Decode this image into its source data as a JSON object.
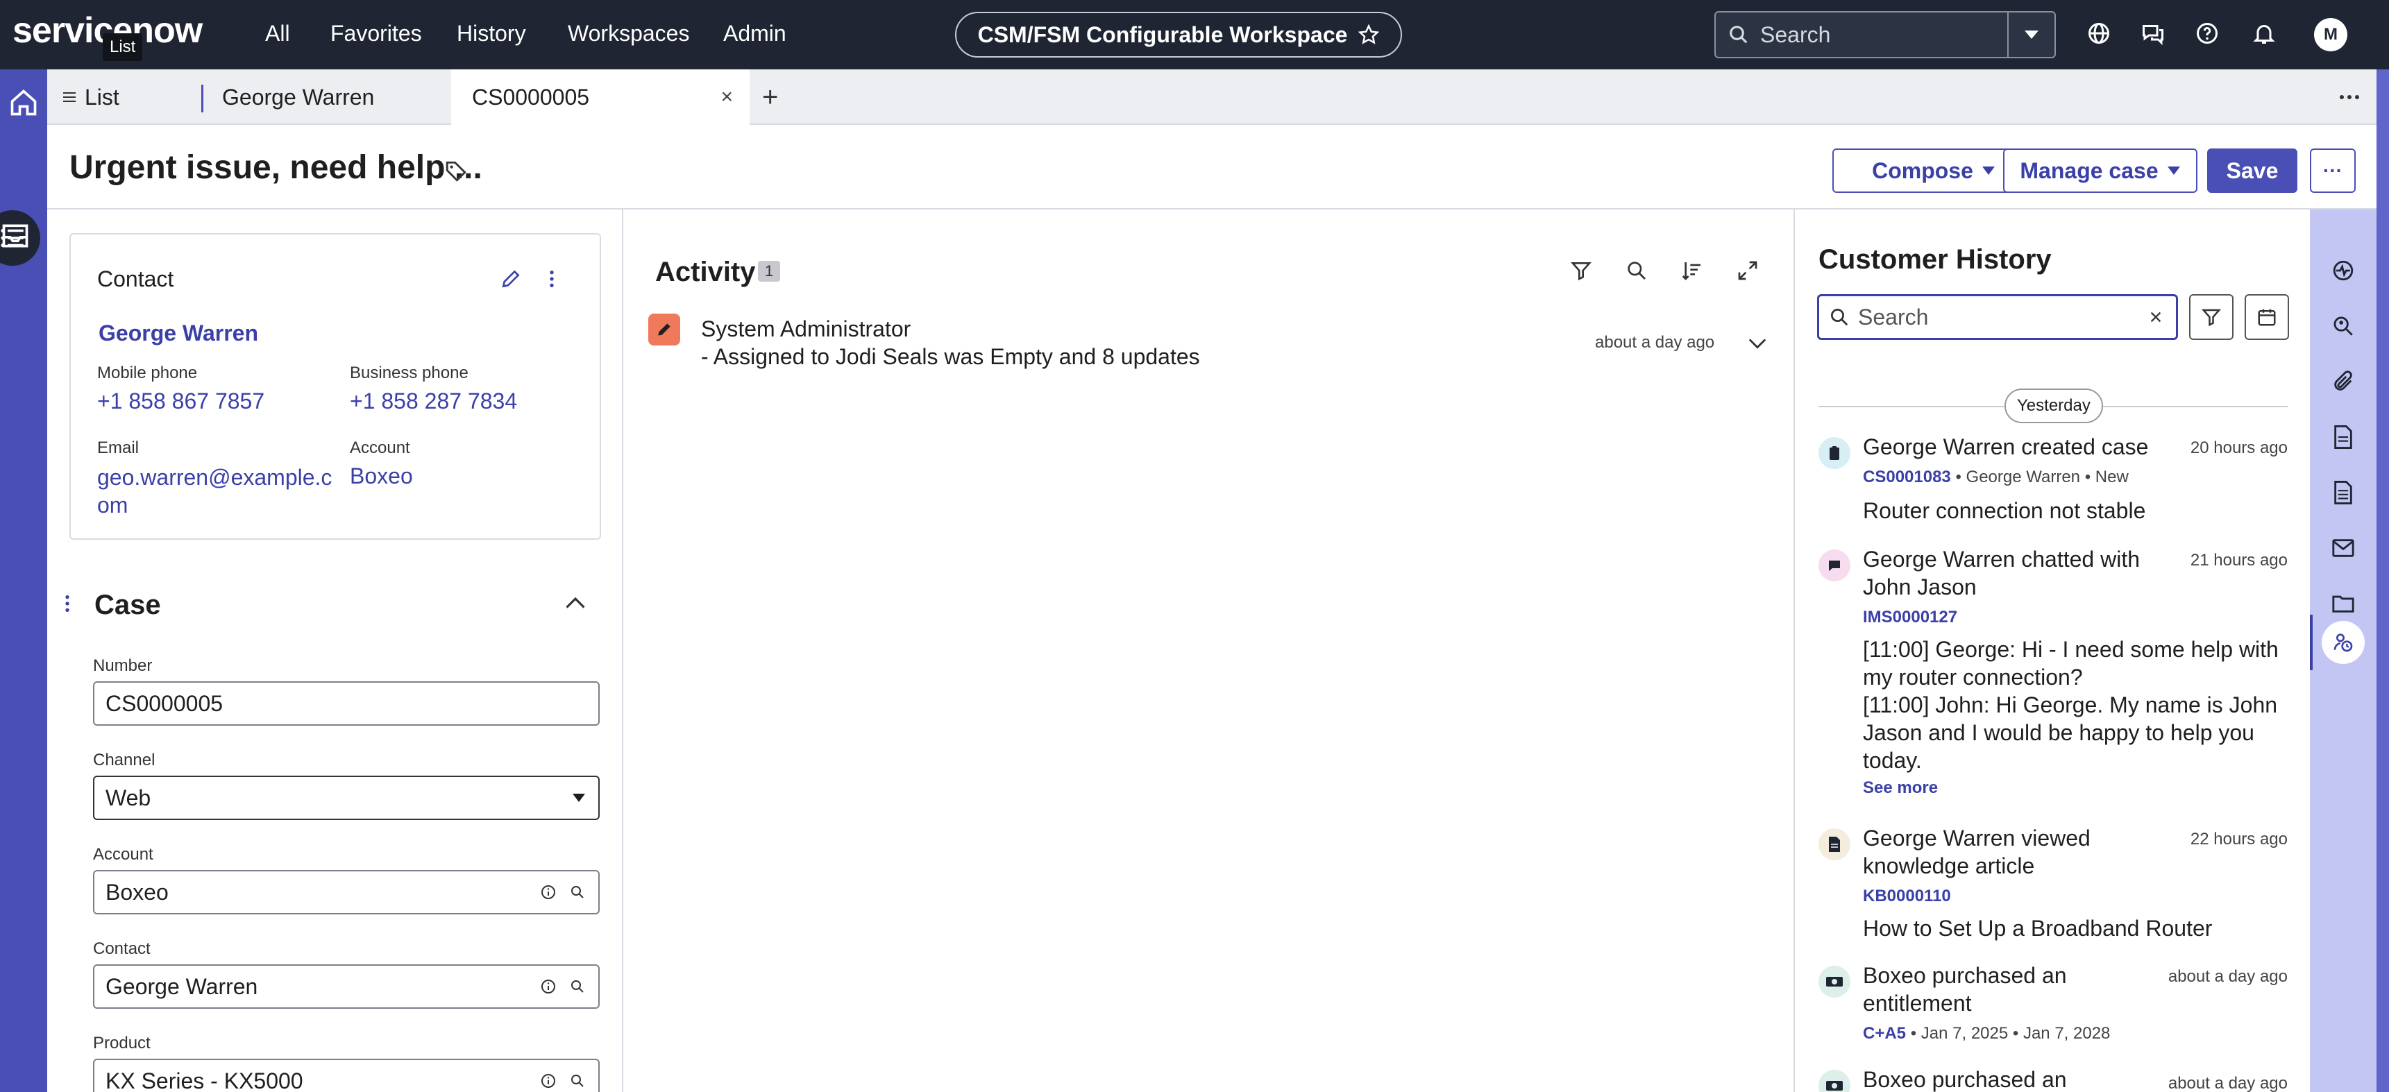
{
  "topnav": {
    "logo": "servicenow",
    "logo_tooltip": "List",
    "links": [
      "All",
      "Favorites",
      "History",
      "Workspaces",
      "Admin"
    ],
    "workspace_name": "CSM/FSM Configurable Workspace",
    "search_placeholder": "Search",
    "avatar_initial": "M"
  },
  "tabs": {
    "list_label": "List",
    "tab1_label": "George Warren",
    "tab2_label": "CS0000005",
    "close_glyph": "×",
    "add_glyph": "+"
  },
  "header": {
    "title": "Urgent issue, need help ...",
    "compose_label": "Compose",
    "manage_label": "Manage case",
    "save_label": "Save",
    "more_label": "···"
  },
  "contact": {
    "heading": "Contact",
    "name": "George Warren",
    "mobile_label": "Mobile phone",
    "mobile_value": "+1 858 867 7857",
    "business_label": "Business phone",
    "business_value": "+1 858 287 7834",
    "email_label": "Email",
    "email_line1": "geo.warren@example.c",
    "email_line2": "om",
    "account_label": "Account",
    "account_value": "Boxeo"
  },
  "case": {
    "heading": "Case",
    "number_label": "Number",
    "number_value": "CS0000005",
    "channel_label": "Channel",
    "channel_value": "Web",
    "account_label": "Account",
    "account_value": "Boxeo",
    "contact_label": "Contact",
    "contact_value": "George Warren",
    "product_label": "Product",
    "product_value": "KX Series - KX5000"
  },
  "activity": {
    "title": "Activity",
    "count": "1",
    "entry_author": "System Administrator",
    "entry_text": "- Assigned to Jodi Seals was Empty and 8 updates",
    "entry_time": "about a day ago"
  },
  "history": {
    "title": "Customer History",
    "search_placeholder": "Search",
    "date_divider": "Yesterday",
    "items": [
      {
        "title_line1": "George Warren created case",
        "time": "20 hours ago",
        "id": "CS0001083",
        "meta": "• George Warren  • New",
        "body": "Router connection not stable"
      },
      {
        "title_line1": "George Warren chatted with",
        "title_line2": "John Jason",
        "time": "21 hours ago",
        "id": "IMS0000127",
        "body_lines": [
          "[11:00] George: Hi - I need some help with",
          "my router connection?",
          "[11:00] John: Hi George. My name is John",
          "Jason and I would be happy to help you",
          "today."
        ],
        "see_more": "See more"
      },
      {
        "title_line1": "George Warren viewed",
        "title_line2": "knowledge article",
        "time": "22 hours ago",
        "id": "KB0000110",
        "body": "How to Set Up a Broadband Router"
      },
      {
        "title_line1": "Boxeo purchased an",
        "title_line2": "entitlement",
        "time": "about a day ago",
        "id": "C+A5",
        "meta": "• Jan 7, 2025  • Jan 7, 2028"
      },
      {
        "title_line1": "Boxeo purchased an",
        "time": "about a day ago"
      }
    ]
  },
  "colors": {
    "nav_bg": "#1f2533",
    "accent": "#4a4fb5",
    "link": "#3b40a8",
    "panel_bg": "#c3c6f2"
  }
}
